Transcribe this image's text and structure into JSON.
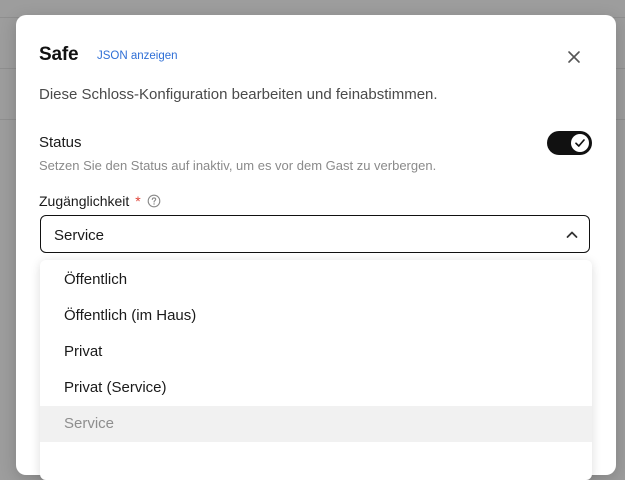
{
  "modal": {
    "title": "Safe",
    "json_link": "JSON anzeigen",
    "subtitle": "Diese Schloss-Konfiguration bearbeiten und feinabstimmen.",
    "close_icon": "close-icon"
  },
  "status": {
    "label": "Status",
    "help": "Setzen Sie den Status auf inaktiv, um es vor dem Gast zu verbergen.",
    "enabled": true,
    "toggle_color": "#111111"
  },
  "accessibility": {
    "label": "Zugänglichkeit",
    "required_mark": "*",
    "help_icon": "question-circle-icon",
    "selected": "Service",
    "options": [
      "Öffentlich",
      "Öffentlich (im Haus)",
      "Privat",
      "Privat (Service)",
      "Service"
    ]
  },
  "colors": {
    "link": "#2f6fd6",
    "required": "#e0453a",
    "selected_option_bg": "#f1f1f1"
  }
}
